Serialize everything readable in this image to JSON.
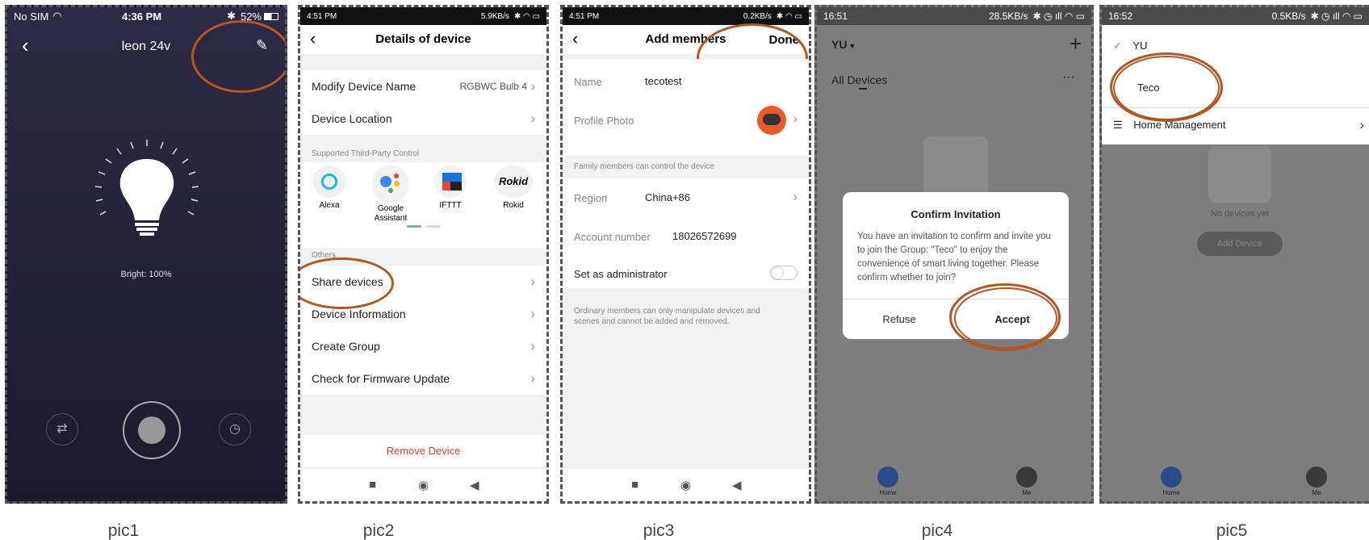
{
  "pic1": {
    "status_left": "No SIM",
    "status_time": "4:36 PM",
    "status_battery": "52%",
    "title": "leon 24v",
    "brightness": "Bright: 100%",
    "caption": "pic1"
  },
  "pic2": {
    "status_time": "4:51 PM",
    "status_speed": "5.9KB/s",
    "title": "Details of device",
    "rows": {
      "modify_name": "Modify Device Name",
      "modify_value": "RGBWC Bulb 4",
      "location": "Device Location"
    },
    "third_party_label": "Supported Third-Party Control",
    "services": [
      "Alexa",
      "Google Assistant",
      "IFTTT",
      "Rokid"
    ],
    "others_label": "Others",
    "menu": [
      "Share devices",
      "Device Information",
      "Create Group",
      "Check for Firmware Update"
    ],
    "remove": "Remove Device",
    "caption": "pic2"
  },
  "pic3": {
    "status_time": "4:51 PM",
    "status_speed": "0.2KB/s",
    "title": "Add members",
    "done": "Done",
    "name_label": "Name",
    "name_value": "tecotest",
    "photo_label": "Profile Photo",
    "family_note": "Family members can control the device",
    "region_label": "Region",
    "region_value": "China+86",
    "account_label": "Account number",
    "account_value": "18026572699",
    "admin_label": "Set as administrator",
    "admin_note": "Ordinary members can only manipulate devices and scenes and cannot be added and removed.",
    "caption": "pic3"
  },
  "pic4": {
    "status_time": "16:51",
    "status_speed": "28.5KB/s",
    "home": "YU",
    "all_devices": "All Devices",
    "dialog_title": "Confirm Invitation",
    "dialog_body": "You have an invitation to confirm and invite you to join the Group: \"Teco\" to enjoy the convenience of smart living together. Please confirm whether to join?",
    "refuse": "Refuse",
    "accept": "Accept",
    "tab_home": "Home",
    "tab_me": "Me",
    "caption": "pic4"
  },
  "pic5": {
    "status_time": "16:52",
    "status_speed": "0.5KB/s",
    "item_yu": "YU",
    "item_teco": "Teco",
    "home_mgmt": "Home Management",
    "no_devices": "No devices yet",
    "add_device": "Add Device",
    "tab_home": "Home",
    "tab_me": "Me",
    "caption": "pic5"
  }
}
